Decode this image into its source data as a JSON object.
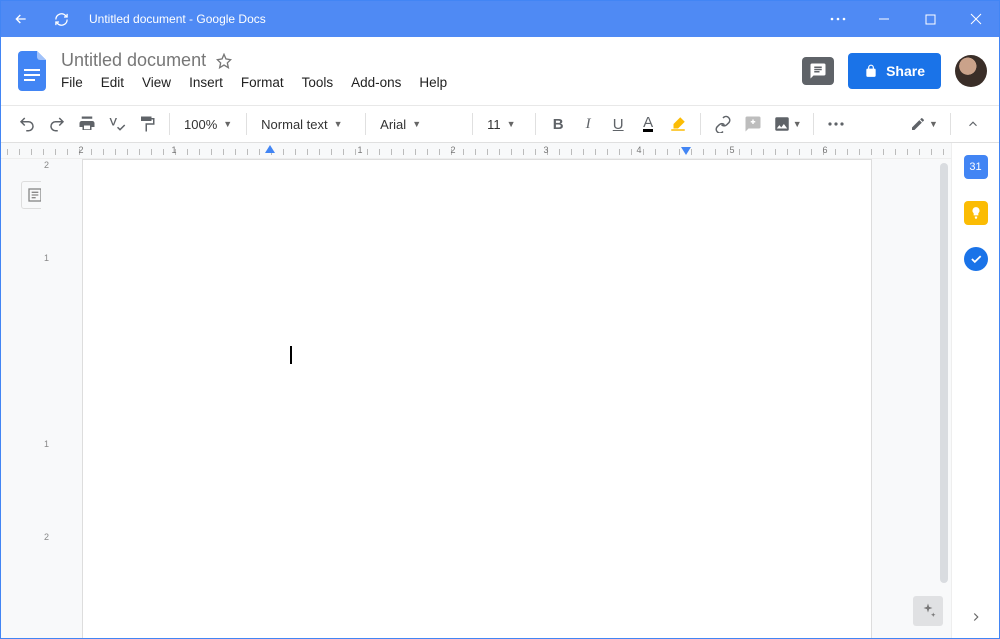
{
  "window": {
    "title": "Untitled document - Google Docs"
  },
  "doc": {
    "title": "Untitled document"
  },
  "menus": [
    "File",
    "Edit",
    "View",
    "Insert",
    "Format",
    "Tools",
    "Add-ons",
    "Help"
  ],
  "share": {
    "label": "Share"
  },
  "toolbar": {
    "zoom": "100%",
    "style": "Normal text",
    "font": "Arial",
    "size": "11"
  },
  "ruler": {
    "labels": [
      "2",
      "1",
      "1",
      "2",
      "3",
      "4",
      "5",
      "6"
    ]
  },
  "vruler": {
    "labels": [
      "2",
      "1",
      "1",
      "2"
    ]
  },
  "sidepanel": {
    "calendar_day": "31"
  }
}
